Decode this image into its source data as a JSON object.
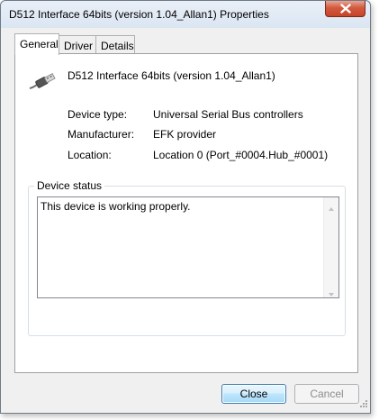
{
  "window": {
    "title": "D512 Interface 64bits (version 1.04_Allan1) Properties"
  },
  "tabs": [
    {
      "label": "General",
      "active": true
    },
    {
      "label": "Driver",
      "active": false
    },
    {
      "label": "Details",
      "active": false
    }
  ],
  "device": {
    "name": "D512 Interface 64bits (version 1.04_Allan1)",
    "icon": "usb-connector-icon",
    "properties": [
      {
        "label": "Device type:",
        "value": "Universal Serial Bus controllers"
      },
      {
        "label": "Manufacturer:",
        "value": "EFK provider"
      },
      {
        "label": "Location:",
        "value": "Location 0 (Port_#0004.Hub_#0001)"
      }
    ]
  },
  "status": {
    "group_title": "Device status",
    "text": "This device is working properly."
  },
  "buttons": {
    "close_label": "Close",
    "cancel_label": "Cancel"
  },
  "colors": {
    "close_button_red": "#c7432a",
    "focus_blue": "#3c7fb1"
  }
}
